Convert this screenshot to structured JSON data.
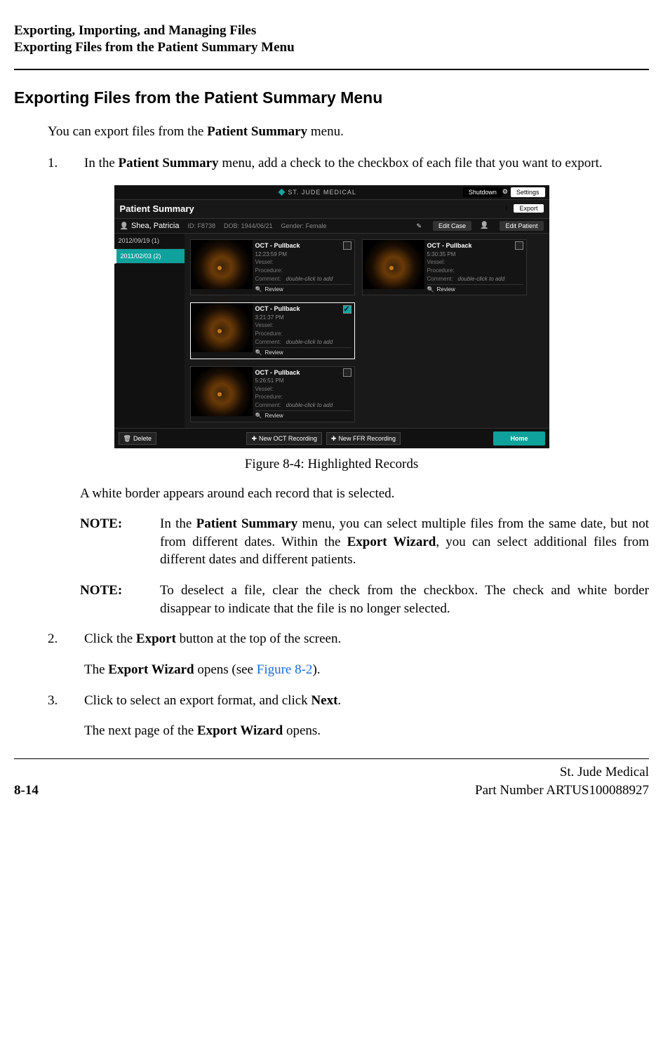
{
  "header": {
    "line1": "Exporting, Importing, and Managing Files",
    "line2": "Exporting Files from the Patient Summary Menu"
  },
  "section_title": "Exporting Files from the Patient Summary Menu",
  "intro_pre": "You can export files from the ",
  "intro_bold": "Patient Summary",
  "intro_post": " menu.",
  "steps": {
    "s1": {
      "num": "1.",
      "t1": "In the ",
      "b1": "Patient Summary",
      "t2": " menu, add a check to the checkbox of each file that you want to export."
    },
    "s2": {
      "num": "2.",
      "t1": "Click the ",
      "b1": "Export",
      "t2": " button at the top of the screen."
    },
    "s2_sub_pre": "The ",
    "s2_sub_bold": "Export Wizard",
    "s2_sub_mid": " opens (see ",
    "s2_sub_link": "Figure 8-2",
    "s2_sub_post": ").",
    "s3": {
      "num": "3.",
      "t1": "Click to select an export format, and click ",
      "b1": "Next",
      "t2": "."
    },
    "s3_sub_pre": "The next page of the ",
    "s3_sub_bold": "Export Wizard",
    "s3_sub_post": " opens."
  },
  "figure": {
    "caption": "Figure 8-4:  Highlighted Records",
    "brand": "ST. JUDE MEDICAL",
    "shutdown": "Shutdown",
    "settings": "Settings",
    "patient_summary": "Patient Summary",
    "export": "Export",
    "patient_name": "Shea, Patricia",
    "id_label": "ID: F8738",
    "dob_label": "DOB: 1944/06/21",
    "gender_label": "Gender: Female",
    "edit_case": "Edit Case",
    "edit_patient": "Edit Patient",
    "dates": [
      {
        "label": "2012/09/19  (1)",
        "active": false
      },
      {
        "label": "2011/02/03  (2)",
        "active": true
      }
    ],
    "cards": [
      {
        "title": "OCT - Pullback",
        "time": "12:23:59 PM",
        "checked": false
      },
      {
        "title": "OCT - Pullback",
        "time": "5:30:35 PM",
        "checked": false
      },
      {
        "title": "OCT - Pullback",
        "time": "3:21:37 PM",
        "checked": true
      },
      {
        "title": "OCT - Pullback",
        "time": "5:26:51 PM",
        "checked": false
      }
    ],
    "card_labels": {
      "vessel": "Vessel:",
      "procedure": "Procedure:",
      "comment": "Comment:",
      "hint": "double-click to add",
      "review": "Review"
    },
    "bottom": {
      "delete": "Delete",
      "new_oct": "New OCT Recording",
      "new_ffr": "New FFR Recording",
      "home": "Home"
    }
  },
  "after_fig": "A white border appears around each record that is selected.",
  "notes": {
    "label": "NOTE:",
    "n1_t1": "In the ",
    "n1_b1": "Patient Summary",
    "n1_t2": " menu, you can select multiple files from the same date, but not from different dates. Within the ",
    "n1_b2": "Export Wizard",
    "n1_t3": ", you can select additional files from different dates and different patients.",
    "n2": "To deselect a file, clear the check from the checkbox. The check and white border disappear to indicate that the file is no longer selected."
  },
  "footer": {
    "page": "8-14",
    "r1": "St. Jude Medical",
    "r2": "Part Number ARTUS100088927"
  }
}
